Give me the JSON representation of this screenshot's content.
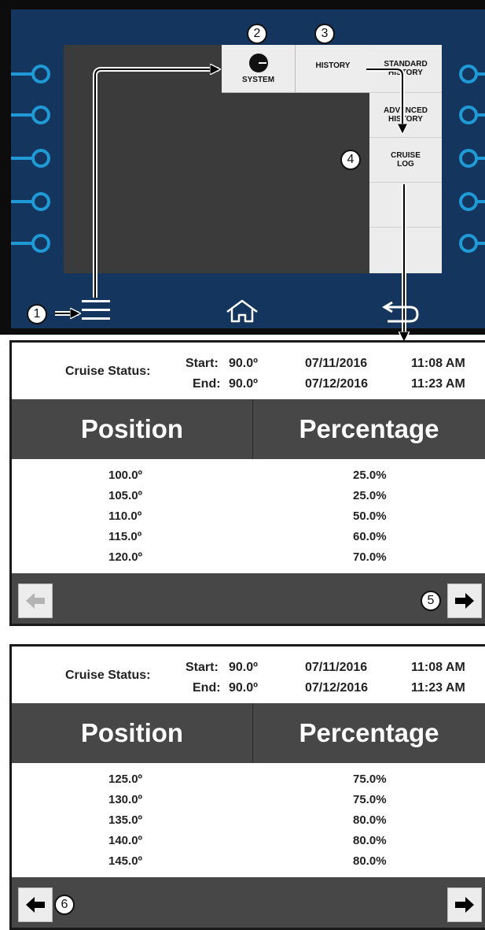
{
  "top_menu": {
    "system_label": "SYSTEM",
    "history_label": "HISTORY",
    "side_items": [
      "STANDARD HISTORY",
      "ADVANCED HISTORY",
      "CRUISE LOG",
      "",
      ""
    ]
  },
  "callouts": [
    "1",
    "2",
    "3",
    "4",
    "5",
    "6"
  ],
  "icons": {
    "menu": "hamburger-icon",
    "home": "home-icon",
    "back": "back-icon",
    "system": "system-gauge-icon",
    "prev": "arrow-left-icon",
    "next": "arrow-right-icon"
  },
  "logs": [
    {
      "status_label": "Cruise Status:",
      "start_label": "Start:",
      "start_value": "90.0º",
      "start_date": "07/11/2016",
      "start_time": "11:08 AM",
      "end_label": "End:",
      "end_value": "90.0º",
      "end_date": "07/12/2016",
      "end_time": "11:23 AM",
      "col_position": "Position",
      "col_percentage": "Percentage",
      "rows": [
        {
          "position": "100.0º",
          "percentage": "25.0%"
        },
        {
          "position": "105.0º",
          "percentage": "25.0%"
        },
        {
          "position": "110.0º",
          "percentage": "50.0%"
        },
        {
          "position": "115.0º",
          "percentage": "60.0%"
        },
        {
          "position": "120.0º",
          "percentage": "70.0%"
        }
      ],
      "prev_enabled": false,
      "next_enabled": true
    },
    {
      "status_label": "Cruise Status:",
      "start_label": "Start:",
      "start_value": "90.0º",
      "start_date": "07/11/2016",
      "start_time": "11:08 AM",
      "end_label": "End:",
      "end_value": "90.0º",
      "end_date": "07/12/2016",
      "end_time": "11:23 AM",
      "col_position": "Position",
      "col_percentage": "Percentage",
      "rows": [
        {
          "position": "125.0º",
          "percentage": "75.0%"
        },
        {
          "position": "130.0º",
          "percentage": "75.0%"
        },
        {
          "position": "135.0º",
          "percentage": "80.0%"
        },
        {
          "position": "140.0º",
          "percentage": "80.0%"
        },
        {
          "position": "145.0º",
          "percentage": "80.0%"
        }
      ],
      "prev_enabled": true,
      "next_enabled": true
    }
  ],
  "colors": {
    "bezel": "#14365e",
    "knob_accent": "#1f9ad6",
    "screen_dark": "#3b3b3b",
    "header_gray": "#474747"
  }
}
